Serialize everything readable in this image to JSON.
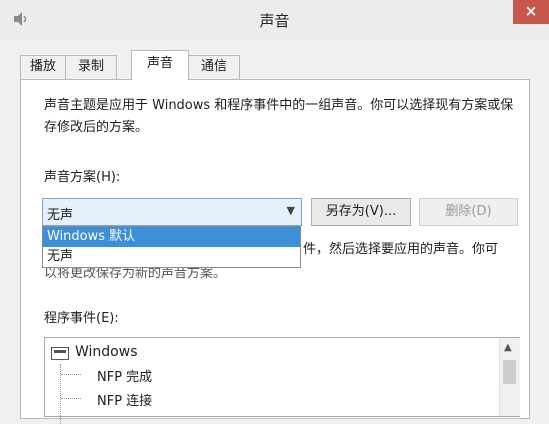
{
  "window": {
    "title": "声音",
    "close_label": "×"
  },
  "tabs": [
    {
      "label": "播放"
    },
    {
      "label": "录制"
    },
    {
      "label": "声音"
    },
    {
      "label": "通信"
    }
  ],
  "sound_tab": {
    "description": "声音主题是应用于 Windows 和程序事件中的一组声音。你可以选择现有方案或保存修改后的方案。",
    "scheme_label": "声音方案(H):",
    "scheme_selected": "无声",
    "save_as_label": "另存为(V)...",
    "delete_label": "删除(D)",
    "dropdown_options": [
      "Windows 默认",
      "无声"
    ],
    "partial_text_line1": "件，然后选择要应用的声音。你可",
    "partial_text_line2": "以将更改保存为新的声音方案。",
    "events_label": "程序事件(E):",
    "events": {
      "group": "Windows",
      "items": [
        "NFP 完成",
        "NFP 连接"
      ]
    }
  }
}
